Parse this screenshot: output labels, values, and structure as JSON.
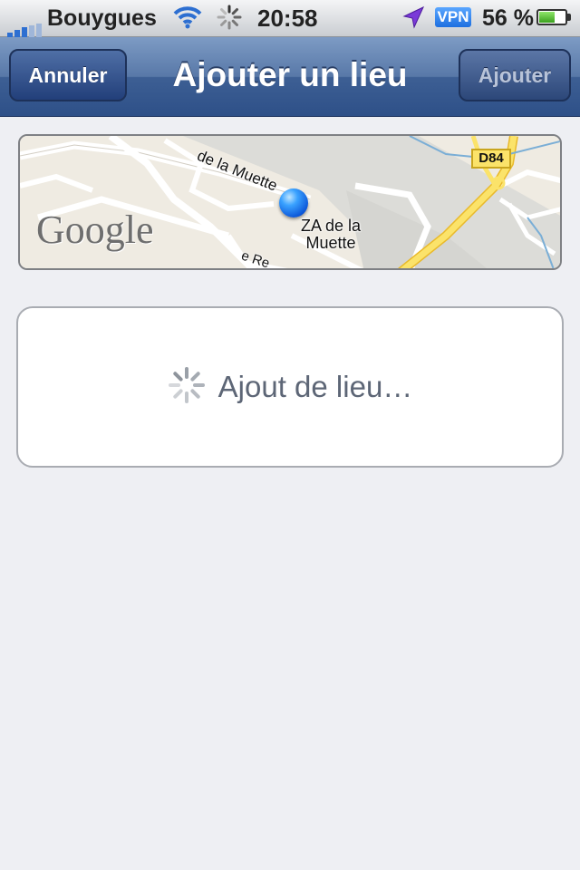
{
  "status_bar": {
    "carrier": "Bouygues",
    "time": "20:58",
    "vpn": "VPN",
    "battery_percent": "56 %",
    "battery_level": 0.56,
    "icons": [
      "signal-icon",
      "wifi-icon",
      "activity-spinner-icon",
      "location-arrow-icon",
      "battery-icon"
    ]
  },
  "nav": {
    "title": "Ajouter un lieu",
    "cancel_label": "Annuler",
    "add_label": "Ajouter"
  },
  "map": {
    "road_label": "de la Muette",
    "place_label_line1": "ZA de la",
    "place_label_line2": "Muette",
    "road_label_2": "e Re",
    "highway_label": "D84",
    "logo": "Google",
    "pin_icon": "location-pin-icon"
  },
  "card": {
    "status_text": "Ajout de lieu…",
    "spinner_icon": "activity-spinner-icon"
  }
}
